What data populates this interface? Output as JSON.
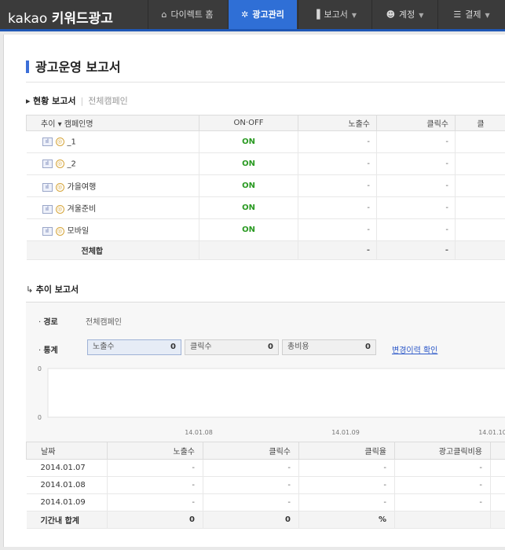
{
  "header": {
    "logo_brand": "kakao",
    "logo_product": "키워드광고",
    "nav": [
      {
        "label": "다이렉트 홈",
        "icon": "home-icon"
      },
      {
        "label": "광고관리",
        "icon": "gear-icon",
        "active": true
      },
      {
        "label": "보고서",
        "icon": "bar-chart-icon"
      },
      {
        "label": "계정",
        "icon": "user-icon"
      },
      {
        "label": "결제",
        "icon": "database-icon"
      }
    ],
    "active_color": "#2f6fd6"
  },
  "page": {
    "title": "광고운영 보고서"
  },
  "status_report": {
    "title": "현황 보고서",
    "subtitle": "전체캠페인",
    "columns": [
      "추이 ▾ 캠페인명",
      "ON·OFF",
      "노출수",
      "클릭수",
      "클"
    ],
    "rows": [
      {
        "name": "_1",
        "status": "ON",
        "impressions": "-",
        "clicks": "-",
        "extra": ""
      },
      {
        "name": "_2",
        "status": "ON",
        "impressions": "-",
        "clicks": "-",
        "extra": ""
      },
      {
        "name": "가을여행",
        "status": "ON",
        "impressions": "-",
        "clicks": "-",
        "extra": ""
      },
      {
        "name": "겨울준비",
        "status": "ON",
        "impressions": "-",
        "clicks": "-",
        "extra": ""
      },
      {
        "name": "모바일",
        "status": "ON",
        "impressions": "-",
        "clicks": "-",
        "extra": ""
      }
    ],
    "total": {
      "label": "전체합",
      "impressions": "-",
      "clicks": "-"
    }
  },
  "trend_report": {
    "title": "추이 보고서",
    "route_label": "경로",
    "route_value": "전체캠페인",
    "stats_label": "통계",
    "stats": [
      {
        "label": "노출수",
        "value": "0",
        "selected": true
      },
      {
        "label": "클릭수",
        "value": "0"
      },
      {
        "label": "총비용",
        "value": "0"
      }
    ],
    "change_link": "변경이력 확인"
  },
  "chart_data": {
    "type": "line",
    "x": [
      "14.01.08",
      "14.01.09",
      "14.01.10"
    ],
    "y_ticks": [
      "0",
      "0"
    ],
    "series": [
      {
        "values": [
          0,
          0,
          0
        ]
      }
    ]
  },
  "daily_table": {
    "columns": [
      "날짜",
      "노출수",
      "클릭수",
      "클릭율",
      "광고클릭비용"
    ],
    "rows": [
      [
        "2014.01.07",
        "-",
        "-",
        "-",
        "-"
      ],
      [
        "2014.01.08",
        "-",
        "-",
        "-",
        "-"
      ],
      [
        "2014.01.09",
        "-",
        "-",
        "-",
        "-"
      ]
    ],
    "total": [
      "기간내 합계",
      "0",
      "0",
      "%",
      ""
    ]
  }
}
